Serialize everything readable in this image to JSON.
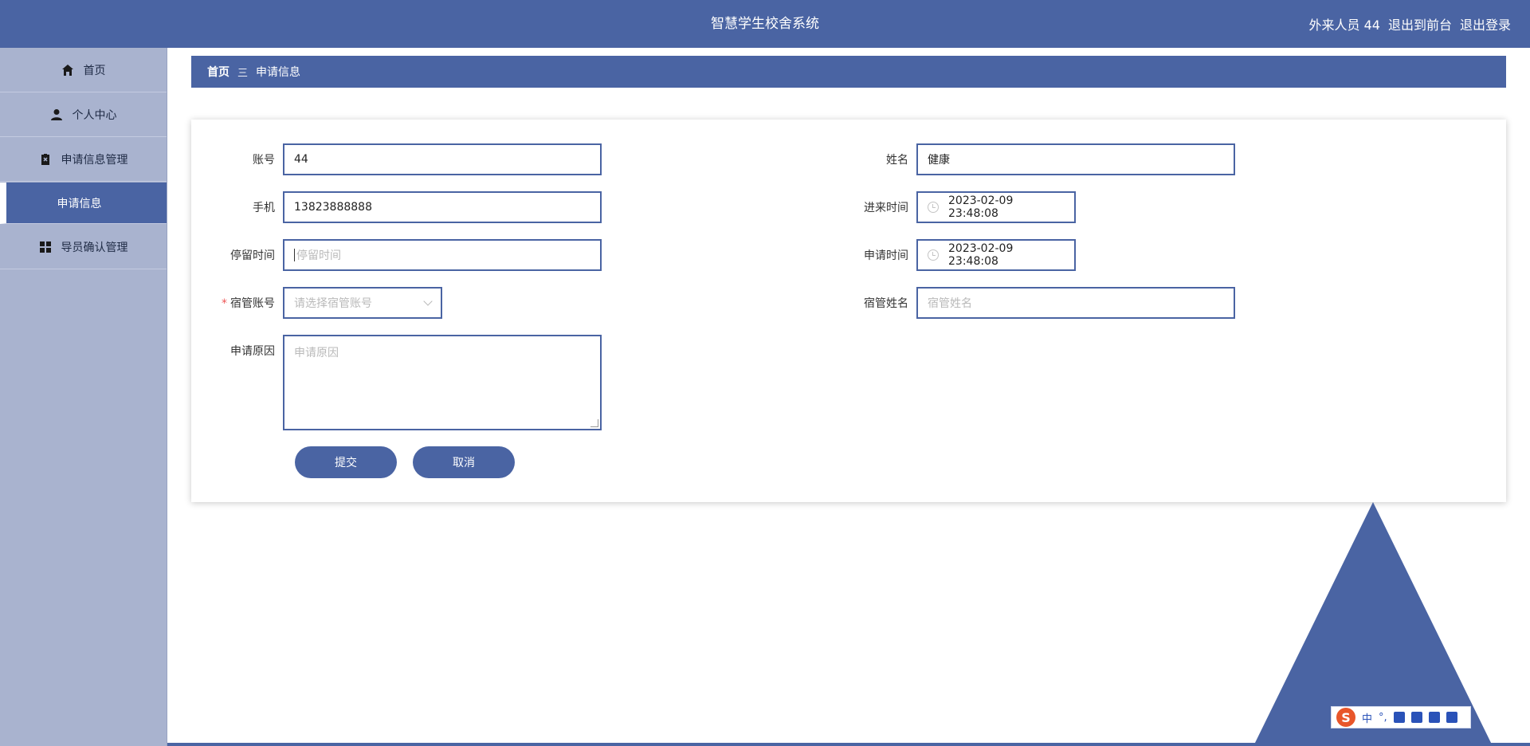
{
  "header": {
    "title": "智慧学生校舍系统",
    "user_label": "外来人员 44",
    "back_front": "退出到前台",
    "logout": "退出登录"
  },
  "sidebar": {
    "items": [
      {
        "label": "首页",
        "icon": "home-icon"
      },
      {
        "label": "个人中心",
        "icon": "user-icon"
      },
      {
        "label": "申请信息管理",
        "icon": "clipboard-icon"
      },
      {
        "label": "申请信息",
        "icon": ""
      },
      {
        "label": "导员确认管理",
        "icon": "grid-icon"
      }
    ]
  },
  "breadcrumb": {
    "home": "首页",
    "separator": "三",
    "current": "申请信息"
  },
  "form": {
    "account": {
      "label": "账号",
      "value": "44"
    },
    "name": {
      "label": "姓名",
      "value": "健康"
    },
    "phone": {
      "label": "手机",
      "value": "13823888888"
    },
    "enter_time": {
      "label": "进来时间",
      "value": "2023-02-09 23:48:08"
    },
    "stay_time": {
      "label": "停留时间",
      "placeholder": "停留时间"
    },
    "apply_time": {
      "label": "申请时间",
      "value": "2023-02-09 23:48:08"
    },
    "dorm_account": {
      "label": "宿管账号",
      "required_mark": "*",
      "placeholder": "请选择宿管账号"
    },
    "dorm_name": {
      "label": "宿管姓名",
      "placeholder": "宿管姓名"
    },
    "reason": {
      "label": "申请原因",
      "placeholder": "申请原因"
    },
    "submit_label": "提交",
    "cancel_label": "取消"
  },
  "ime_bar": {
    "logo": "S",
    "mode": "中",
    "punct": "°,"
  },
  "colors": {
    "accent": "#4a64a3",
    "sidebar_bg": "#a9b3cf"
  }
}
